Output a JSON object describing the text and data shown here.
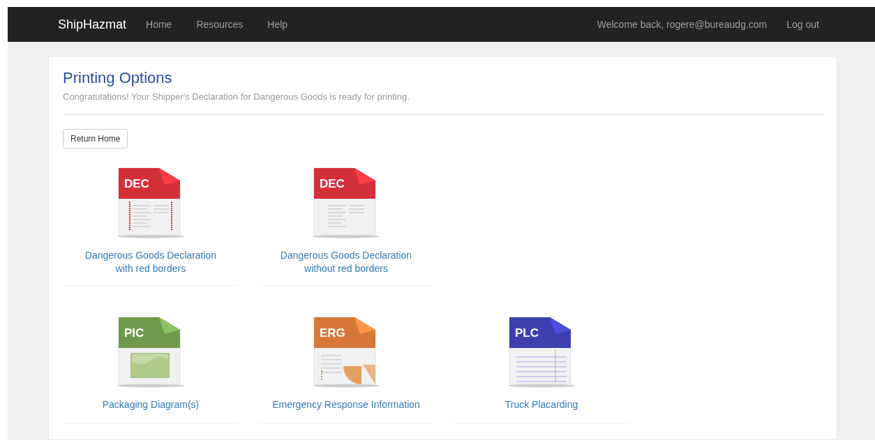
{
  "navbar": {
    "brand": "ShipHazmat",
    "links": [
      "Home",
      "Resources",
      "Help"
    ],
    "welcome": "Welcome back, rogere@bureaudg.com",
    "logout": "Log out"
  },
  "header": {
    "title": "Printing Options",
    "subtitle": "Congratulations! Your Shipper's Declaration for Dangerous Goods is ready for printing."
  },
  "return_button": "Return Home",
  "tile_rows": [
    [
      {
        "badge": "DEC",
        "color": "#d3303a",
        "kind": "form",
        "red_borders": true,
        "label_lines": [
          "Dangerous Goods Declaration",
          "with red borders"
        ]
      },
      {
        "badge": "DEC",
        "color": "#d3303a",
        "kind": "form",
        "red_borders": false,
        "label_lines": [
          "Dangerous Goods Declaration",
          "without red borders"
        ]
      }
    ],
    [
      {
        "badge": "PIC",
        "color": "#6f9a4e",
        "kind": "picture",
        "label_lines": [
          "Packaging Diagram(s)"
        ]
      },
      {
        "badge": "ERG",
        "color": "#d7783a",
        "kind": "chart",
        "label_lines": [
          "Emergency Response Information"
        ]
      },
      {
        "badge": "PLC",
        "color": "#3d3fb0",
        "kind": "lined",
        "label_lines": [
          "Truck Placarding"
        ]
      }
    ]
  ]
}
